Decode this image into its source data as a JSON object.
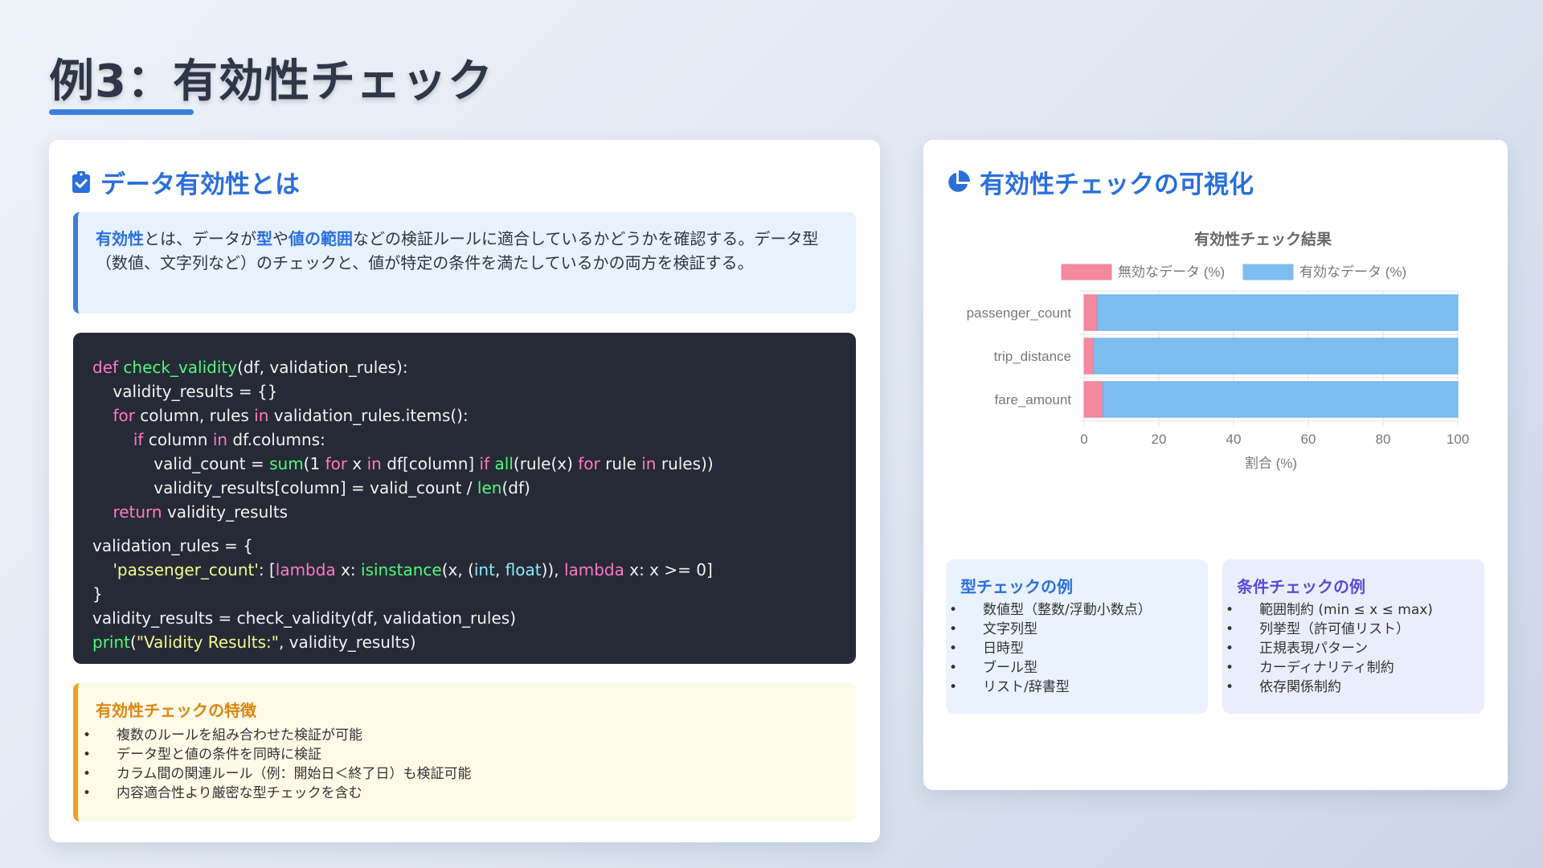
{
  "page": {
    "title": "例3：有効性チェック"
  },
  "left_card": {
    "heading": "データ有効性とは",
    "heading_icon": "clipboard-check-icon",
    "intro": {
      "part1": "有効性",
      "part2": "とは、データが",
      "part3": "型",
      "part4": "や",
      "part5": "値の範囲",
      "part6": "などの検証ルールに適合しているかどうかを確認する。データ型（数値、文字列など）のチェックと、値が特定の条件を満たしているかの両方を検証する。"
    },
    "code_lines": [
      [
        {
          "t": "def ",
          "c": "kw"
        },
        {
          "t": "check_validity",
          "c": "fn"
        },
        {
          "t": "(df, validation_rules):",
          "c": ""
        }
      ],
      [
        {
          "t": "    validity_results = {}",
          "c": ""
        }
      ],
      [
        {
          "t": "    ",
          "c": ""
        },
        {
          "t": "for",
          "c": "kw"
        },
        {
          "t": " column, rules ",
          "c": ""
        },
        {
          "t": "in",
          "c": "kw"
        },
        {
          "t": " validation_rules.items():",
          "c": ""
        }
      ],
      [
        {
          "t": "        ",
          "c": ""
        },
        {
          "t": "if",
          "c": "kw"
        },
        {
          "t": " column ",
          "c": ""
        },
        {
          "t": "in",
          "c": "kw"
        },
        {
          "t": " df.columns:",
          "c": ""
        }
      ],
      [
        {
          "t": "            valid_count = ",
          "c": ""
        },
        {
          "t": "sum",
          "c": "fn"
        },
        {
          "t": "(1 ",
          "c": ""
        },
        {
          "t": "for",
          "c": "kw"
        },
        {
          "t": " x ",
          "c": ""
        },
        {
          "t": "in",
          "c": "kw"
        },
        {
          "t": " df[column] ",
          "c": ""
        },
        {
          "t": "if",
          "c": "kw"
        },
        {
          "t": " ",
          "c": ""
        },
        {
          "t": "all",
          "c": "fn"
        },
        {
          "t": "(rule(x) ",
          "c": ""
        },
        {
          "t": "for",
          "c": "kw"
        },
        {
          "t": " rule ",
          "c": ""
        },
        {
          "t": "in",
          "c": "kw"
        },
        {
          "t": " rules))",
          "c": ""
        }
      ],
      [
        {
          "t": "            validity_results[column] = valid_count / ",
          "c": ""
        },
        {
          "t": "len",
          "c": "fn"
        },
        {
          "t": "(df)",
          "c": ""
        }
      ],
      [
        {
          "t": "    ",
          "c": ""
        },
        {
          "t": "return",
          "c": "kw"
        },
        {
          "t": " validity_results",
          "c": ""
        }
      ],
      "gap",
      [
        {
          "t": "validation_rules = {",
          "c": ""
        }
      ],
      [
        {
          "t": "    ",
          "c": ""
        },
        {
          "t": "'passenger_count'",
          "c": "st"
        },
        {
          "t": ": [",
          "c": ""
        },
        {
          "t": "lambda",
          "c": "kw"
        },
        {
          "t": " x: ",
          "c": ""
        },
        {
          "t": "isinstance",
          "c": "fn"
        },
        {
          "t": "(x, (",
          "c": ""
        },
        {
          "t": "int",
          "c": "ty"
        },
        {
          "t": ", ",
          "c": ""
        },
        {
          "t": "float",
          "c": "ty"
        },
        {
          "t": ")), ",
          "c": ""
        },
        {
          "t": "lambda",
          "c": "kw"
        },
        {
          "t": " x: x >= 0]",
          "c": ""
        }
      ],
      [
        {
          "t": "}",
          "c": ""
        }
      ],
      [
        {
          "t": "validity_results = check_validity(df, validation_rules)",
          "c": ""
        }
      ],
      [
        {
          "t": "print",
          "c": "fn"
        },
        {
          "t": "(",
          "c": ""
        },
        {
          "t": "\"Validity Results:\"",
          "c": "st"
        },
        {
          "t": ", validity_results)",
          "c": ""
        }
      ]
    ],
    "features": {
      "title": "有効性チェックの特徴",
      "items": [
        "複数のルールを組み合わせた検証が可能",
        "データ型と値の条件を同時に検証",
        "カラム間の関連ルール（例：開始日＜終了日）も検証可能",
        "内容適合性より厳密な型チェックを含む"
      ]
    }
  },
  "right_card": {
    "heading": "有効性チェックの可視化",
    "heading_icon": "pie-chart-icon",
    "type_examples": {
      "title": "型チェックの例",
      "items": [
        "数値型（整数/浮動小数点）",
        "文字列型",
        "日時型",
        "ブール型",
        "リスト/辞書型"
      ]
    },
    "condition_examples": {
      "title": "条件チェックの例",
      "items": [
        "範囲制約 (min ≤ x ≤ max)",
        "列挙型（許可値リスト）",
        "正規表現パターン",
        "カーディナリティ制約",
        "依存関係制約"
      ]
    }
  },
  "chart_data": {
    "type": "bar",
    "orientation": "horizontal",
    "stacked": true,
    "title": "有効性チェック結果",
    "categories": [
      "passenger_count",
      "trip_distance",
      "fare_amount"
    ],
    "series": [
      {
        "name": "無効なデータ (%)",
        "values": [
          3.5,
          2.5,
          5
        ],
        "color": "#f4899e"
      },
      {
        "name": "有効なデータ (%)",
        "values": [
          96.5,
          97.5,
          95
        ],
        "color": "#7dbdf0"
      }
    ],
    "xlabel": "割合 (%)",
    "ylabel": "",
    "xlim": [
      0,
      100
    ],
    "xticks": [
      0,
      20,
      40,
      60,
      80,
      100
    ],
    "grid": true,
    "legend_position": "top"
  },
  "colors": {
    "accent": "#2a6fdb",
    "code_bg": "#262a36",
    "warning": "#f0a020"
  }
}
